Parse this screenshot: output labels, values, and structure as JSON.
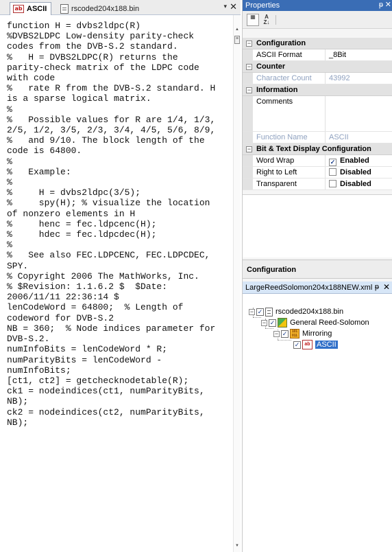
{
  "editor": {
    "tabs": [
      {
        "label": "ASCII",
        "icon": "ascii-ab-icon"
      },
      {
        "label": "rscoded204x188.bin",
        "icon": "document-icon"
      }
    ],
    "menu_glyph": "▾",
    "close_glyph": "✕",
    "lines": [
      "function H = dvbs2ldpc(R)",
      "%DVBS2LDPC Low-density parity-check",
      "codes from the DVB-S.2 standard.",
      "%   H = DVBS2LDPC(R) returns the",
      "parity-check matrix of the LDPC code",
      "with code",
      "%   rate R from the DVB-S.2 standard. H",
      "is a sparse logical matrix.",
      "%",
      "%   Possible values for R are 1/4, 1/3,",
      "2/5, 1/2, 3/5, 2/3, 3/4, 4/5, 5/6, 8/9,",
      "%   and 9/10. The block length of the",
      "code is 64800.",
      "%",
      "%   Example:",
      "%",
      "%     H = dvbs2ldpc(3/5);",
      "%     spy(H); % visualize the location",
      "of nonzero elements in H",
      "%     henc = fec.ldpcenc(H);",
      "%     hdec = fec.ldpcdec(H);",
      "%",
      "%   See also FEC.LDPCENC, FEC.LDPCDEC,",
      "SPY.",
      "",
      "% Copyright 2006 The MathWorks, Inc.",
      "% $Revision: 1.1.6.2 $  $Date:",
      "2006/11/11 22:36:14 $",
      "",
      "lenCodeWord = 64800;  % Length of",
      "codeword for DVB-S.2",
      "NB = 360;  % Node indices parameter for",
      "DVB-S.2.",
      "",
      "numInfoBits = lenCodeWord * R;",
      "numParityBits = lenCodeWord -",
      "numInfoBits;",
      "",
      "[ct1, ct2] = getchecknodetable(R);",
      "",
      "ck1 = nodeindices(ct1, numParityBits,",
      "NB);",
      "ck2 = nodeindices(ct2, numParityBits,",
      "NB);"
    ]
  },
  "properties": {
    "title": "Properties",
    "pin_glyph": "ᵽ",
    "close_glyph": "✕",
    "toolbar": {
      "categorized_icon": "categorized-icon",
      "alphabetical_label": "A\nZ↓"
    },
    "categories": [
      {
        "label": "Configuration",
        "rows": [
          {
            "name": "ASCII Format",
            "value": "_8Bit"
          }
        ]
      },
      {
        "label": "Counter",
        "rows": [
          {
            "name": "Character Count",
            "value": "43992",
            "readonly": true
          }
        ]
      },
      {
        "label": "Information",
        "rows": [
          {
            "name": "Comments",
            "value": "",
            "tall": true
          },
          {
            "name": "Function Name",
            "value": "ASCII",
            "readonly": true
          }
        ]
      },
      {
        "label": "Bit & Text Display Configuration",
        "rows": [
          {
            "name": "Word Wrap",
            "value": "Enabled",
            "checked": true
          },
          {
            "name": "Right to Left",
            "value": "Disabled",
            "checked": false
          },
          {
            "name": "Transparent",
            "value": "Disabled",
            "checked": false
          }
        ]
      }
    ]
  },
  "configuration": {
    "title": "Configuration",
    "tree_title": "LargeReedSolomon204x188NEW.xml",
    "tree": [
      {
        "label": "rscoded204x188.bin",
        "icon": "document-icon"
      },
      {
        "label": "General Reed-Solomon",
        "icon": "reed-solomon-icon"
      },
      {
        "label": "Mirroring",
        "icon": "mirroring-icon"
      },
      {
        "label": "ASCII",
        "icon": "ascii-ab-icon",
        "selected": true
      }
    ]
  }
}
